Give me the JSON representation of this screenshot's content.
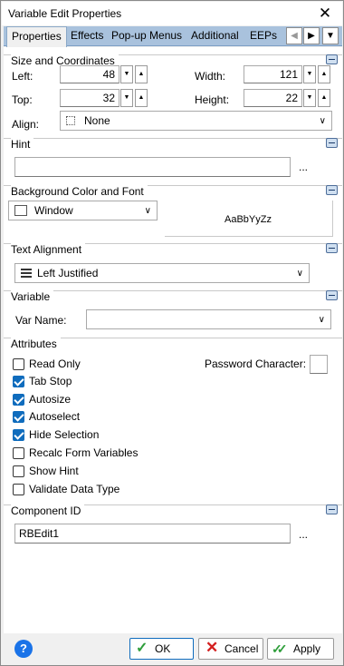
{
  "window": {
    "title": "Variable Edit Properties",
    "close_glyph": "✕"
  },
  "tabs": [
    {
      "label": "Properties"
    },
    {
      "label": "Effects"
    },
    {
      "label": "Pop-up Menus"
    },
    {
      "label": "Additional"
    },
    {
      "label": "EEPs"
    }
  ],
  "tab_scroll": {
    "left": "◀",
    "right": "▶",
    "menu": "▼"
  },
  "size_section": {
    "title": "Size and Coordinates",
    "left_label": "Left:",
    "left_value": "48",
    "top_label": "Top:",
    "top_value": "32",
    "width_label": "Width:",
    "width_value": "121",
    "height_label": "Height:",
    "height_value": "22",
    "align_label": "Align:",
    "align_value": "None"
  },
  "spin_glyphs": {
    "down": "▼",
    "up": "▲"
  },
  "hint_section": {
    "title": "Hint",
    "value": "",
    "ellipsis": "..."
  },
  "bg_section": {
    "title": "Background Color and Font",
    "color_value": "Window",
    "font_sample": "AaBbYyZz"
  },
  "align_section": {
    "title": "Text Alignment",
    "value": "Left Justified"
  },
  "variable_section": {
    "title": "Variable",
    "varname_label": "Var Name:",
    "varname_value": ""
  },
  "attributes": {
    "title": "Attributes",
    "password_label": "Password Character:",
    "items": [
      {
        "label": "Read Only",
        "checked": false
      },
      {
        "label": "Tab Stop",
        "checked": true
      },
      {
        "label": "Autosize",
        "checked": true
      },
      {
        "label": "Autoselect",
        "checked": true
      },
      {
        "label": "Hide Selection",
        "checked": true
      },
      {
        "label": "Recalc Form Variables",
        "checked": false
      },
      {
        "label": "Show Hint",
        "checked": false
      },
      {
        "label": "Validate Data Type",
        "checked": false
      }
    ]
  },
  "component_section": {
    "title": "Component ID",
    "value": "RBEdit1",
    "ellipsis": "..."
  },
  "footer": {
    "help": "?",
    "ok_label": "OK",
    "cancel_label": "Cancel",
    "apply_label": "Apply"
  }
}
